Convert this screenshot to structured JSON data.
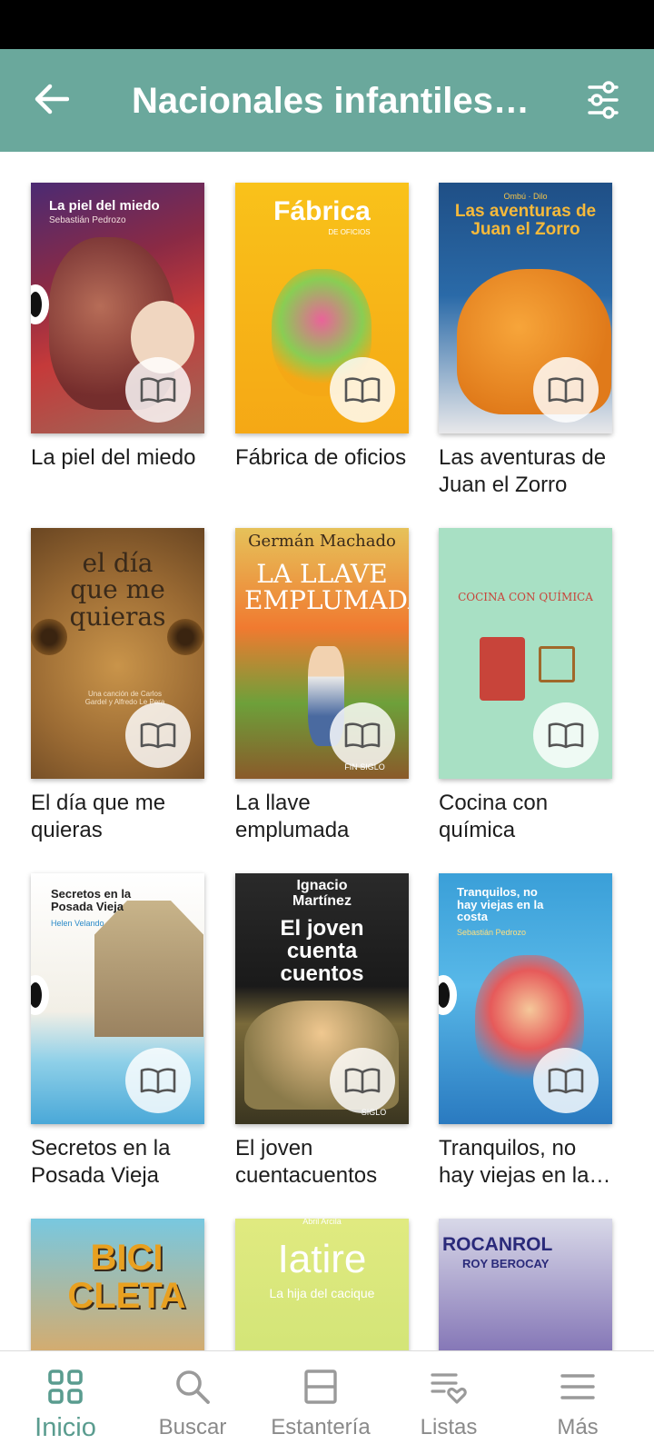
{
  "header": {
    "title": "Nacionales infantiles…",
    "bg_color": "#6aa89c",
    "back_icon": "arrow-left-icon",
    "filter_icon": "sliders-icon"
  },
  "books": [
    {
      "title": "La piel del miedo",
      "cover_title": "La piel del miedo",
      "cover_author": "Sebastián Pedrozo"
    },
    {
      "title": "Fábrica de oficios",
      "cover_title": "Fábrica",
      "cover_sub": "DE OFICIOS"
    },
    {
      "title": "Las aventuras de Juan el Zorro",
      "cover_top": "Ombú · Dilo",
      "cover_title": "Las aventuras de Juan el Zorro"
    },
    {
      "title": "El día que me quieras",
      "cover_title": "el día que me quieras",
      "cover_small": "Una canción de Carlos Gardel y Alfredo Le Pera"
    },
    {
      "title": "La llave emplumada",
      "cover_author": "Germán Machado",
      "cover_title": "LA LLAVE EMPLUMADA",
      "cover_brand": "FIN SIGLO"
    },
    {
      "title": "Cocina con química",
      "cover_title": "COCINA CON QUÍMICA"
    },
    {
      "title": "Secretos en la Posada Vieja",
      "cover_title": "Secretos en la Posada Vieja",
      "cover_author": "Helen Velando"
    },
    {
      "title": "El joven cuentacuentos",
      "cover_author": "Ignacio Martínez",
      "cover_title": "El joven cuenta cuentos",
      "cover_brand": "SIGLO"
    },
    {
      "title": "Tranquilos, no hay viejas en la…",
      "cover_title": "Tranquilos, no hay viejas en la costa",
      "cover_author": "Sebastián Pedrozo"
    },
    {
      "title": "",
      "cover_title": "BICI CLETA"
    },
    {
      "title": "",
      "cover_top": "Abril Arcila",
      "cover_title": "Iatire",
      "cover_sub": "La hija del cacique"
    },
    {
      "title": "",
      "cover_title": "ROCANROL",
      "cover_author": "ROY BEROCAY"
    }
  ],
  "read_icon": "open-book-icon",
  "nav": {
    "active_color": "#5a9c8f",
    "items": [
      {
        "label": "Inicio",
        "icon": "grid-icon"
      },
      {
        "label": "Buscar",
        "icon": "search-icon"
      },
      {
        "label": "Estantería",
        "icon": "shelf-icon"
      },
      {
        "label": "Listas",
        "icon": "list-heart-icon"
      },
      {
        "label": "Más",
        "icon": "menu-icon"
      }
    ]
  }
}
